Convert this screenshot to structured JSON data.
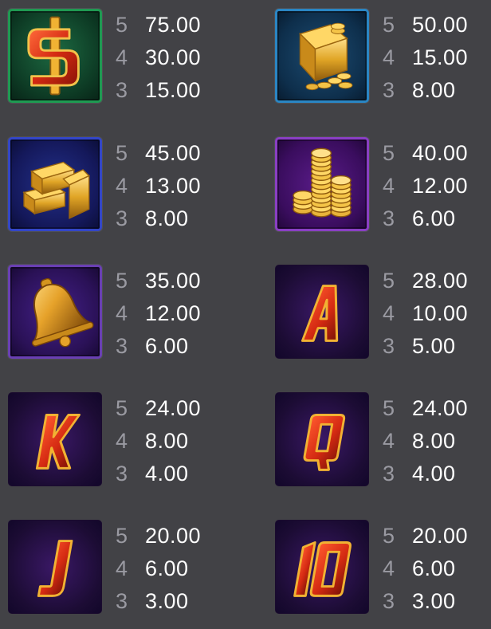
{
  "paytable": {
    "symbols": [
      {
        "name": "dollar-sign",
        "icon": "dollar-sign-icon",
        "frame_color": "#1f9a52",
        "background": "#0d3a24",
        "payouts": [
          {
            "count": "5",
            "value": "75.00"
          },
          {
            "count": "4",
            "value": "30.00"
          },
          {
            "count": "3",
            "value": "15.00"
          }
        ]
      },
      {
        "name": "gold-bars-and-coins",
        "icon": "gold-bars-coins-icon",
        "frame_color": "#2a86c4",
        "background": "#0e2f4c",
        "payouts": [
          {
            "count": "5",
            "value": "50.00"
          },
          {
            "count": "4",
            "value": "15.00"
          },
          {
            "count": "3",
            "value": "8.00"
          }
        ]
      },
      {
        "name": "gold-bars",
        "icon": "gold-bars-icon",
        "frame_color": "#3346c8",
        "background": "#14185a",
        "payouts": [
          {
            "count": "5",
            "value": "45.00"
          },
          {
            "count": "4",
            "value": "13.00"
          },
          {
            "count": "3",
            "value": "8.00"
          }
        ]
      },
      {
        "name": "gold-coins",
        "icon": "gold-coins-icon",
        "frame_color": "#8a3fc4",
        "background": "#3a0d5e",
        "payouts": [
          {
            "count": "5",
            "value": "40.00"
          },
          {
            "count": "4",
            "value": "12.00"
          },
          {
            "count": "3",
            "value": "6.00"
          }
        ]
      },
      {
        "name": "golden-bell",
        "icon": "bell-icon",
        "frame_color": "#6a3fb4",
        "background": "#2a1156",
        "payouts": [
          {
            "count": "5",
            "value": "35.00"
          },
          {
            "count": "4",
            "value": "12.00"
          },
          {
            "count": "3",
            "value": "6.00"
          }
        ]
      },
      {
        "name": "letter-a",
        "icon": "letter-a-icon",
        "glyph": "A",
        "frame_color": "",
        "background": "#1c0c34",
        "payouts": [
          {
            "count": "5",
            "value": "28.00"
          },
          {
            "count": "4",
            "value": "10.00"
          },
          {
            "count": "3",
            "value": "5.00"
          }
        ]
      },
      {
        "name": "letter-k",
        "icon": "letter-k-icon",
        "glyph": "K",
        "frame_color": "",
        "background": "#1c0c34",
        "payouts": [
          {
            "count": "5",
            "value": "24.00"
          },
          {
            "count": "4",
            "value": "8.00"
          },
          {
            "count": "3",
            "value": "4.00"
          }
        ]
      },
      {
        "name": "letter-q",
        "icon": "letter-q-icon",
        "glyph": "Q",
        "frame_color": "",
        "background": "#1c0c34",
        "payouts": [
          {
            "count": "5",
            "value": "24.00"
          },
          {
            "count": "4",
            "value": "8.00"
          },
          {
            "count": "3",
            "value": "4.00"
          }
        ]
      },
      {
        "name": "letter-j",
        "icon": "letter-j-icon",
        "glyph": "J",
        "frame_color": "",
        "background": "#1c0c34",
        "payouts": [
          {
            "count": "5",
            "value": "20.00"
          },
          {
            "count": "4",
            "value": "6.00"
          },
          {
            "count": "3",
            "value": "3.00"
          }
        ]
      },
      {
        "name": "number-10",
        "icon": "number-10-icon",
        "glyph": "10",
        "frame_color": "",
        "background": "#1c0c34",
        "payouts": [
          {
            "count": "5",
            "value": "20.00"
          },
          {
            "count": "4",
            "value": "6.00"
          },
          {
            "count": "3",
            "value": "3.00"
          }
        ]
      }
    ]
  }
}
